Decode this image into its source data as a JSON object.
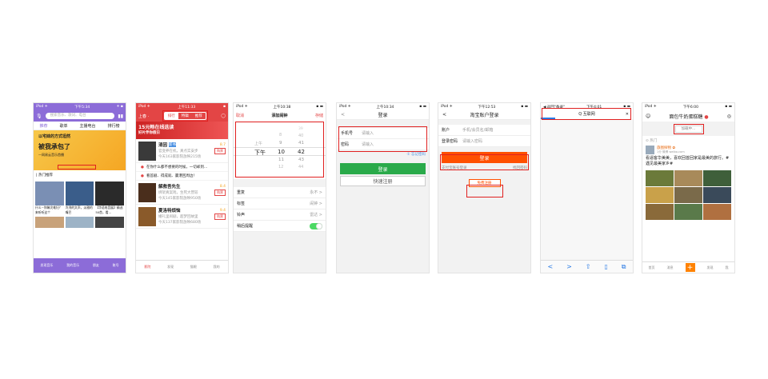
{
  "status": {
    "p1": {
      "carrier": "iPod ✈",
      "time": "下午5:34",
      "right": "✈ ▪"
    },
    "p2": {
      "carrier": "iPod ✈",
      "time": "上午11:33",
      "right": "▪"
    },
    "p3": {
      "carrier": "iPod ✈",
      "time": "上午10:38",
      "right": "▪ ▬"
    },
    "p4": {
      "carrier": "iPod ✈",
      "time": "上午10:34",
      "right": "▪ ▬"
    },
    "p5": {
      "carrier": "iPod ✈",
      "time": "下午12:53",
      "right": "▪ ▬"
    },
    "p6": {
      "carrier": "◀ 返回\"备录\"",
      "time": "下午4:01",
      "right": "▪ ▬"
    },
    "p7": {
      "carrier": "iPod ✈",
      "time": "下午6:00",
      "right": "▪ ▬"
    }
  },
  "p1": {
    "search_placeholder": "搜索音乐、歌词、电台",
    "tabs": [
      "推荐",
      "歌单",
      "主播电台",
      "排行榜"
    ],
    "banner_line1": "以宅妹的方式坦然",
    "banner_line2": "被我承包了",
    "banner_line3": "—网易云音乐首播",
    "section": "| 热门推荐",
    "cells": [
      {
        "caption": "什么~你嘛灾难妇？来听听这个",
        "color": "#7a8fb4"
      },
      {
        "caption": "冷冽的文声，淡雅的嘴巴",
        "color": "#3a5d8a"
      },
      {
        "caption": "【华语电音展】精选50首，看…",
        "color": "#2a2a2a"
      },
      {
        "caption": "",
        "color": "#c8a27a"
      },
      {
        "caption": "",
        "color": "#9db3c6"
      },
      {
        "caption": "",
        "color": "#444"
      }
    ],
    "tabbar": [
      "发现音乐",
      "我的音乐",
      "朋友",
      "账号"
    ]
  },
  "p2": {
    "left": "上春 ·",
    "seg": [
      "排行",
      "特辑",
      "推荐"
    ],
    "ad_line1": "15元畅在线选读",
    "ad_line2": "好片伴你假日",
    "items": [
      {
        "title": "清因",
        "tag": "新书",
        "score": "8.7",
        "l1": "官变养在机，真点实安步",
        "l2": "今天163家影院放映215场",
        "btn": "购票",
        "color": "#3a3a3a"
      },
      {
        "title": "解救吾先生",
        "tag": "",
        "score": "8.4",
        "l1": "绑架真案戏，生死大营较",
        "l2": "今天145家影院放映950场",
        "btn": "购票",
        "color": "#4a2e1c"
      },
      {
        "title": "夏洛特烦恼",
        "tag": "",
        "score": "9.4",
        "l1": "婚礼里闹剧，超梦回故里",
        "l2": "今天137家影院放映680场",
        "btn": "购票",
        "color": "#8a5a2a"
      }
    ],
    "subs": [
      "在你什么都不想要的时候，一切却到…",
      "看首剧、得成就、赢港回周边！"
    ],
    "tabbar": [
      "影院",
      "发现",
      "猫眼",
      "我的"
    ]
  },
  "p3": {
    "cancel": "取消",
    "title": "添加闹钟",
    "save": "存储",
    "col_ampm": [
      "上午",
      "下午"
    ],
    "col_hour": [
      "8",
      "9",
      "10",
      "11",
      "12"
    ],
    "col_min": [
      "39",
      "40",
      "41",
      "42",
      "43",
      "44"
    ],
    "options": [
      {
        "label": "重复",
        "value": "永不 >"
      },
      {
        "label": "标签",
        "value": "闹钟 >"
      },
      {
        "label": "铃声",
        "value": "雷达 >"
      },
      {
        "label": "稍后提醒",
        "value": ""
      }
    ]
  },
  "p4": {
    "back": "<",
    "title": "登录",
    "fields": [
      {
        "label": "手机号",
        "placeholder": "请输入"
      },
      {
        "label": "密码",
        "placeholder": "请输入"
      }
    ],
    "forgot": "① 忘记密码",
    "login": "登录",
    "register": "快速注册"
  },
  "p5": {
    "back": "<",
    "title": "淘宝账户登录",
    "fields": [
      {
        "label": "账户",
        "placeholder": "手机/会员名/邮箱"
      },
      {
        "label": "登录密码",
        "placeholder": "请输入密码"
      }
    ],
    "login": "登录",
    "alipay": "支付宝账号登录",
    "forgot": "找回密码",
    "register": "免费注册"
  },
  "p6": {
    "title": "Q 互联网",
    "close": "✕",
    "toolbar": [
      "<",
      ">",
      "⇧",
      "▯",
      "⧉"
    ]
  },
  "p7": {
    "title": "面包牛奶蛋糕糖",
    "loading": "加载中...",
    "hot": "⊙ 热门",
    "user": "旅图探物 ✿",
    "meta": "1分 微博 weibo.com",
    "text": "看逼客华美美，喜欢回首回家是最美的旅行。#遇见最美家乡#",
    "tabbar": [
      "首页",
      "消息",
      "+",
      "发现",
      "我"
    ],
    "pics": [
      "#6b7a3a",
      "#a88a5a",
      "#3f5f3a",
      "#c9a14a",
      "#7a6a4a",
      "#3a4a5a",
      "#8a6a3a",
      "#5a7a4a",
      "#b07040"
    ]
  }
}
